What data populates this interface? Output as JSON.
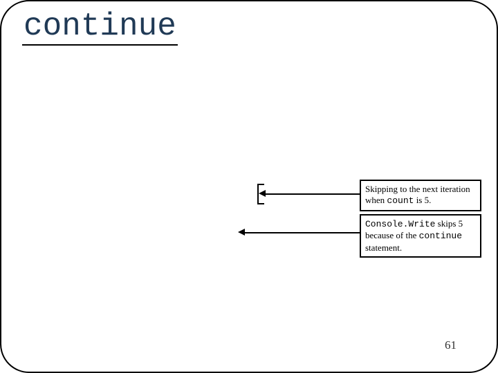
{
  "title": "continue",
  "annotations": {
    "skip": {
      "line1": "Skipping to the next iteration",
      "line2_prefix": "when ",
      "line2_code": "count",
      "line2_suffix": " is 5."
    },
    "console": {
      "line1_code": "Console.Write",
      "line1_suffix": " skips 5",
      "line2_prefix": "because of the ",
      "line2_code": "continue",
      "line3": "statement."
    }
  },
  "page_number": "61"
}
